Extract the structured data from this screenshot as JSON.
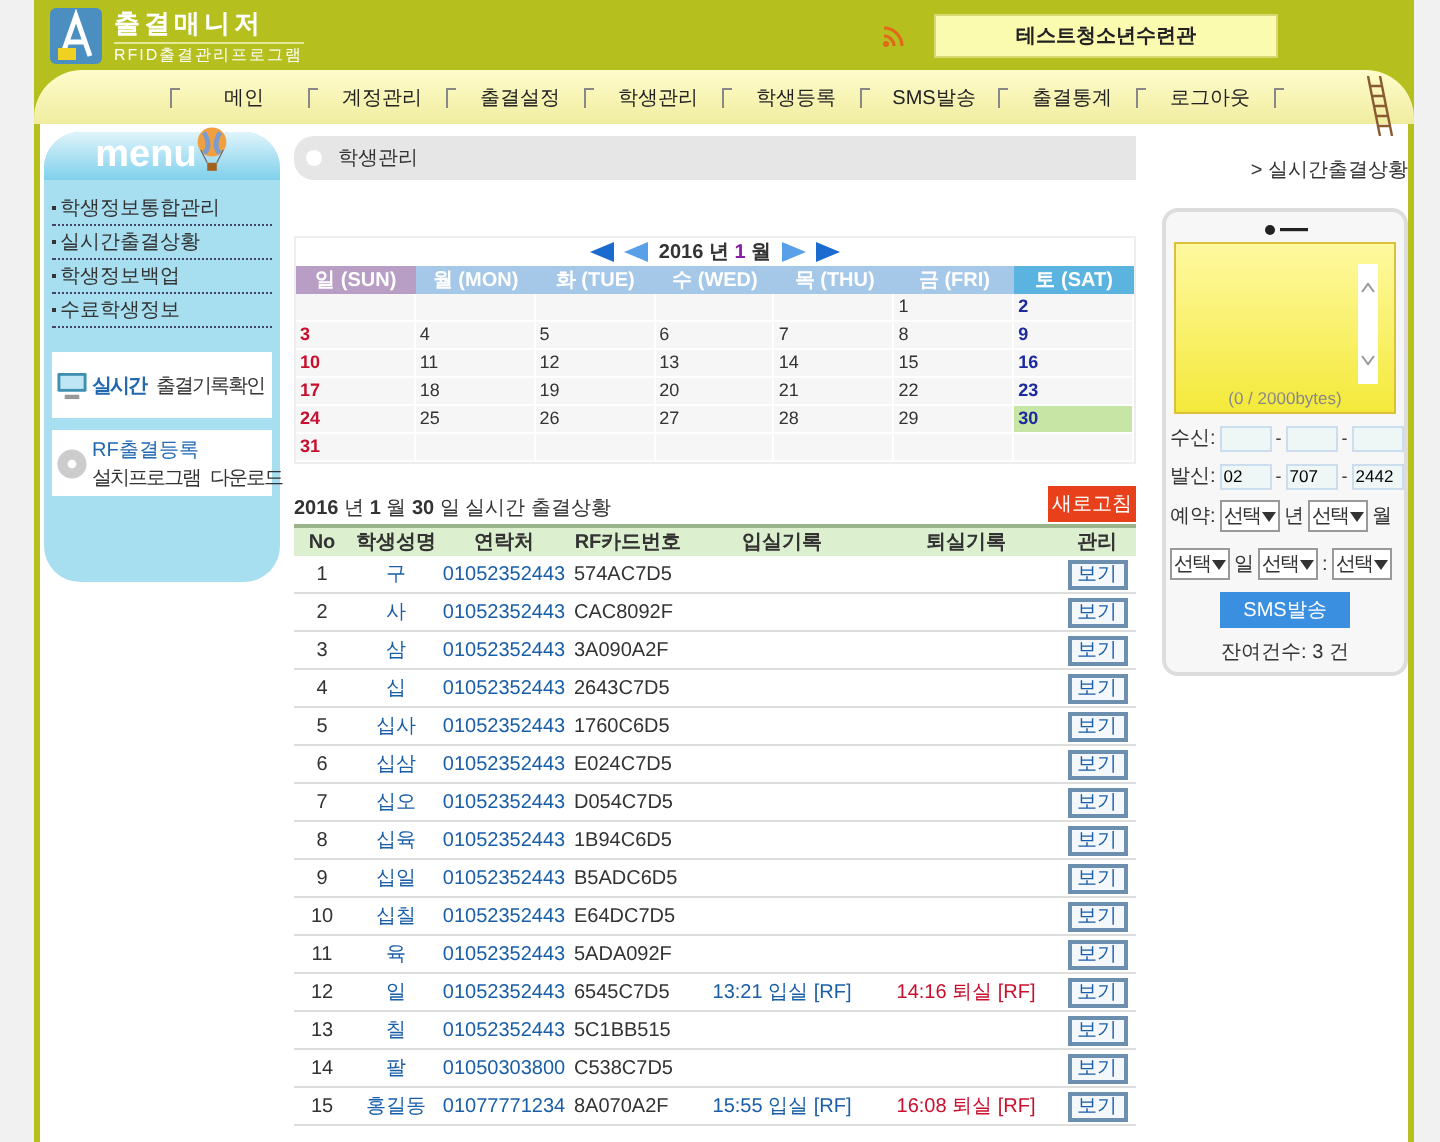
{
  "header": {
    "title": "출결매니저",
    "subtitle": "RFID출결관리프로그램",
    "organization": "테스트청소년수련관"
  },
  "nav": [
    {
      "label": "메인"
    },
    {
      "label": "계정관리"
    },
    {
      "label": "출결설정"
    },
    {
      "label": "학생관리"
    },
    {
      "label": "학생등록"
    },
    {
      "label": "SMS발송"
    },
    {
      "label": "출결통계"
    },
    {
      "label": "로그아웃"
    }
  ],
  "sidebar": {
    "title": "menu",
    "items": [
      "학생정보통합관리",
      "실시간출결상황",
      "학생정보백업",
      "수료학생정보"
    ],
    "cards": [
      {
        "kind": "monitor",
        "text": "**실시간** 출결기록확인"
      },
      {
        "kind": "disc",
        "title": "RF출결등록",
        "text": "설치프로그램 다운로드"
      }
    ]
  },
  "section": {
    "title": "학생관리",
    "link": "> 실시간출결상황"
  },
  "calendar": {
    "year": "2016",
    "year_unit": "년",
    "month": "1",
    "month_unit": "월",
    "weekdays": [
      "일 (SUN)",
      "월 (MON)",
      "화 (TUE)",
      "수 (WED)",
      "목 (THU)",
      "금 (FRI)",
      "토 (SAT)"
    ],
    "weeks": [
      [
        {
          "day": "1",
          "selected": false
        },
        {
          "day": "2",
          "selected": false
        }
      ],
      [
        {
          "day": "3",
          "selected": false
        },
        {
          "day": "4",
          "selected": false
        },
        {
          "day": "5",
          "selected": false
        },
        {
          "day": "6",
          "selected": false
        },
        {
          "day": "7",
          "selected": false
        },
        {
          "day": "8",
          "selected": false
        },
        {
          "day": "9",
          "selected": false
        }
      ],
      [
        {
          "day": "10",
          "selected": false
        },
        {
          "day": "11",
          "selected": false
        },
        {
          "day": "12",
          "selected": false
        },
        {
          "day": "13",
          "selected": false
        },
        {
          "day": "14",
          "selected": false
        },
        {
          "day": "15",
          "selected": false
        },
        {
          "day": "16",
          "selected": false
        }
      ],
      [
        {
          "day": "17",
          "selected": false
        },
        {
          "day": "18",
          "selected": false
        },
        {
          "day": "19",
          "selected": false
        },
        {
          "day": "20",
          "selected": false
        },
        {
          "day": "21",
          "selected": false
        },
        {
          "day": "22",
          "selected": false
        },
        {
          "day": "23",
          "selected": false
        }
      ],
      [
        {
          "day": "24",
          "selected": false
        },
        {
          "day": "25",
          "selected": false
        },
        {
          "day": "26",
          "selected": false
        },
        {
          "day": "27",
          "selected": false
        },
        {
          "day": "28",
          "selected": false
        },
        {
          "day": "29",
          "selected": false
        },
        {
          "day": "30",
          "selected": true
        }
      ],
      [
        {
          "day": "31",
          "selected": false
        }
      ]
    ]
  },
  "attendance": {
    "heading": "**2016** 년 **1** 월 **30** 일 실시간 출결상황",
    "refresh_button": "새로고침",
    "columns": [
      "No",
      "학생성명",
      "연락처",
      "RF카드번호",
      "입실기록",
      "퇴실기록",
      "관리"
    ],
    "rows": [
      {
        "no": "1",
        "name": "구",
        "phone": "01052352443",
        "card": "574AC7D5",
        "check_in": null,
        "check_out": null,
        "action": "보기"
      },
      {
        "no": "2",
        "name": "사",
        "phone": "01052352443",
        "card": "CAC8092F",
        "check_in": null,
        "check_out": null,
        "action": "보기"
      },
      {
        "no": "3",
        "name": "삼",
        "phone": "01052352443",
        "card": "3A090A2F",
        "check_in": null,
        "check_out": null,
        "action": "보기"
      },
      {
        "no": "4",
        "name": "십",
        "phone": "01052352443",
        "card": "2643C7D5",
        "check_in": null,
        "check_out": null,
        "action": "보기"
      },
      {
        "no": "5",
        "name": "십사",
        "phone": "01052352443",
        "card": "1760C6D5",
        "check_in": null,
        "check_out": null,
        "action": "보기"
      },
      {
        "no": "6",
        "name": "십삼",
        "phone": "01052352443",
        "card": "E024C7D5",
        "check_in": null,
        "check_out": null,
        "action": "보기"
      },
      {
        "no": "7",
        "name": "십오",
        "phone": "01052352443",
        "card": "D054C7D5",
        "check_in": null,
        "check_out": null,
        "action": "보기"
      },
      {
        "no": "8",
        "name": "십육",
        "phone": "01052352443",
        "card": "1B94C6D5",
        "check_in": null,
        "check_out": null,
        "action": "보기"
      },
      {
        "no": "9",
        "name": "십일",
        "phone": "01052352443",
        "card": "B5ADC6D5",
        "check_in": null,
        "check_out": null,
        "action": "보기"
      },
      {
        "no": "10",
        "name": "십칠",
        "phone": "01052352443",
        "card": "E64DC7D5",
        "check_in": null,
        "check_out": null,
        "action": "보기"
      },
      {
        "no": "11",
        "name": "육",
        "phone": "01052352443",
        "card": "5ADA092F",
        "check_in": null,
        "check_out": null,
        "action": "보기"
      },
      {
        "no": "12",
        "name": "일",
        "phone": "01052352443",
        "card": "6545C7D5",
        "check_in": "13:21 입실 [RF]",
        "check_out": "14:16 퇴실 [RF]",
        "action": "보기"
      },
      {
        "no": "13",
        "name": "칠",
        "phone": "01052352443",
        "card": "5C1BB515",
        "check_in": null,
        "check_out": null,
        "action": "보기"
      },
      {
        "no": "14",
        "name": "팔",
        "phone": "01050303800",
        "card": "C538C7D5",
        "check_in": null,
        "check_out": null,
        "action": "보기"
      },
      {
        "no": "15",
        "name": "홍길동",
        "phone": "01077771234",
        "card": "8A070A2F",
        "check_in": "15:55 입실 [RF]",
        "check_out": "16:08 퇴실 [RF]",
        "action": "보기"
      }
    ]
  },
  "sms": {
    "counter": "(0 / 2000bytes)",
    "recipient_label": "수신:",
    "recipient": [
      {
        "kind": "input"
      },
      {
        "kind": "input"
      },
      {
        "kind": "input"
      }
    ],
    "sender_label": "발신:",
    "sender": [
      {
        "value": "02"
      },
      {
        "value": "707"
      },
      {
        "value": "2442"
      }
    ],
    "separator": "-",
    "reserve_label": "예약:",
    "reserve": [
      {
        "kind": "select",
        "text": "선택"
      },
      {
        "kind": "unit",
        "text": "년"
      },
      {
        "kind": "select",
        "text": "선택"
      },
      {
        "kind": "unit",
        "text": "월"
      },
      {
        "kind": "break"
      },
      {
        "kind": "select",
        "text": "선택"
      },
      {
        "kind": "unit",
        "text": "일"
      },
      {
        "kind": "select",
        "text": "선택"
      },
      {
        "kind": "unit",
        "text": ":"
      },
      {
        "kind": "select",
        "text": "선택"
      }
    ],
    "send_button": "SMS발송",
    "remaining": "잔여건수: 3 건"
  }
}
